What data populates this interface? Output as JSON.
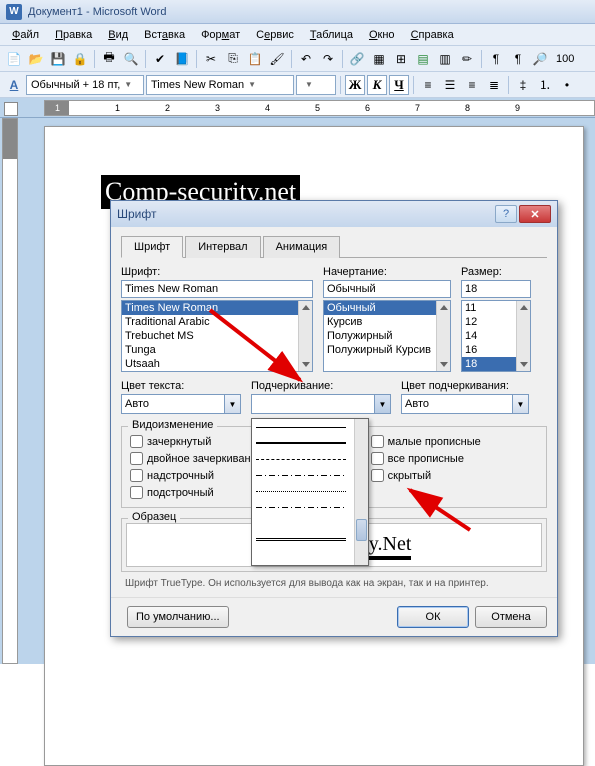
{
  "titlebar": {
    "text": "Документ1 - Microsoft Word"
  },
  "menu": {
    "items": [
      "Файл",
      "Правка",
      "Вид",
      "Вставка",
      "Формат",
      "Сервис",
      "Таблица",
      "Окно",
      "Справка"
    ]
  },
  "toolbar2": {
    "style": "Обычный + 18 пт,",
    "font": "Times New Roman",
    "size_empty": "",
    "bold": "Ж",
    "italic": "К",
    "underline": "Ч",
    "zoom": "100"
  },
  "ruler": {
    "marks": [
      "1",
      "",
      "1",
      "2",
      "3",
      "4",
      "5",
      "6",
      "7",
      "8",
      "9"
    ]
  },
  "page_text": "Comp-security.net",
  "dialog": {
    "title": "Шрифт",
    "tabs": [
      "Шрифт",
      "Интервал",
      "Анимация"
    ],
    "font_label": "Шрифт:",
    "font_value": "Times New Roman",
    "font_list": [
      "Times New Roman",
      "Traditional Arabic",
      "Trebuchet MS",
      "Tunga",
      "Utsaah"
    ],
    "style_label": "Начертание:",
    "style_value": "Обычный",
    "style_list": [
      "Обычный",
      "Курсив",
      "Полужирный",
      "Полужирный Курсив"
    ],
    "size_label": "Размер:",
    "size_value": "18",
    "size_list": [
      "11",
      "12",
      "14",
      "16",
      "18"
    ],
    "textcolor_label": "Цвет текста:",
    "textcolor_value": "Авто",
    "underline_label": "Подчеркивание:",
    "underline_value": "",
    "ulcolor_label": "Цвет подчеркивания:",
    "ulcolor_value": "Авто",
    "effects_label": "Видоизменение",
    "effects_left": [
      "зачеркнутый",
      "двойное зачеркивани",
      "надстрочный",
      "подстрочный"
    ],
    "effects_right": [
      "малые прописные",
      "все прописные",
      "скрытый"
    ],
    "sample_label": "Образец",
    "sample_text": "Comp-Security.Net",
    "hint": "Шрифт TrueType. Он используется для вывода как на экран, так и на принтер.",
    "default_btn": "По умолчанию...",
    "ok_btn": "ОК",
    "cancel_btn": "Отмена"
  }
}
